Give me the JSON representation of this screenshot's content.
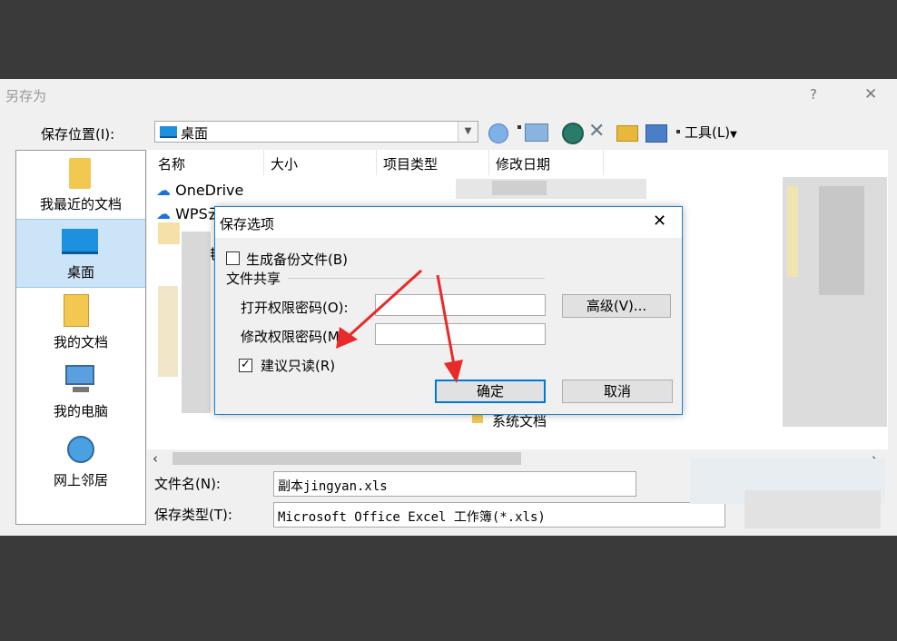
{
  "saveas": {
    "title": "另存为",
    "help": "?",
    "close": "✕",
    "save_location_label": "保存位置(I):",
    "save_location_value": "桌面",
    "tools_label": "工具(L)",
    "places": [
      {
        "label": "我最近的文档"
      },
      {
        "label": "桌面"
      },
      {
        "label": "我的文档"
      },
      {
        "label": "我的电脑"
      },
      {
        "label": "网上邻居"
      }
    ],
    "columns": [
      "名称",
      "大小",
      "项目类型",
      "修改日期"
    ],
    "files": [
      {
        "name": "OneDrive"
      },
      {
        "name": "WPS云文档"
      }
    ],
    "partial_text": "的电",
    "system_docs": "系统文档",
    "filename_label": "文件名(N):",
    "filename_value": "副本jingyan.xls",
    "filetype_label": "保存类型(T):",
    "filetype_value": "Microsoft Office Excel 工作簿(*.xls)"
  },
  "options": {
    "title": "保存选项",
    "close": "✕",
    "backup_label": "生成备份文件(B)",
    "backup_checked": false,
    "sharing_label": "文件共享",
    "open_pwd_label": "打开权限密码(O):",
    "open_pwd_value": "",
    "modify_pwd_label": "修改权限密码(M):",
    "modify_pwd_value": "",
    "advanced_label": "高级(V)...",
    "readonly_label": "建议只读(R)",
    "readonly_checked": true,
    "ok_label": "确定",
    "cancel_label": "取消"
  }
}
